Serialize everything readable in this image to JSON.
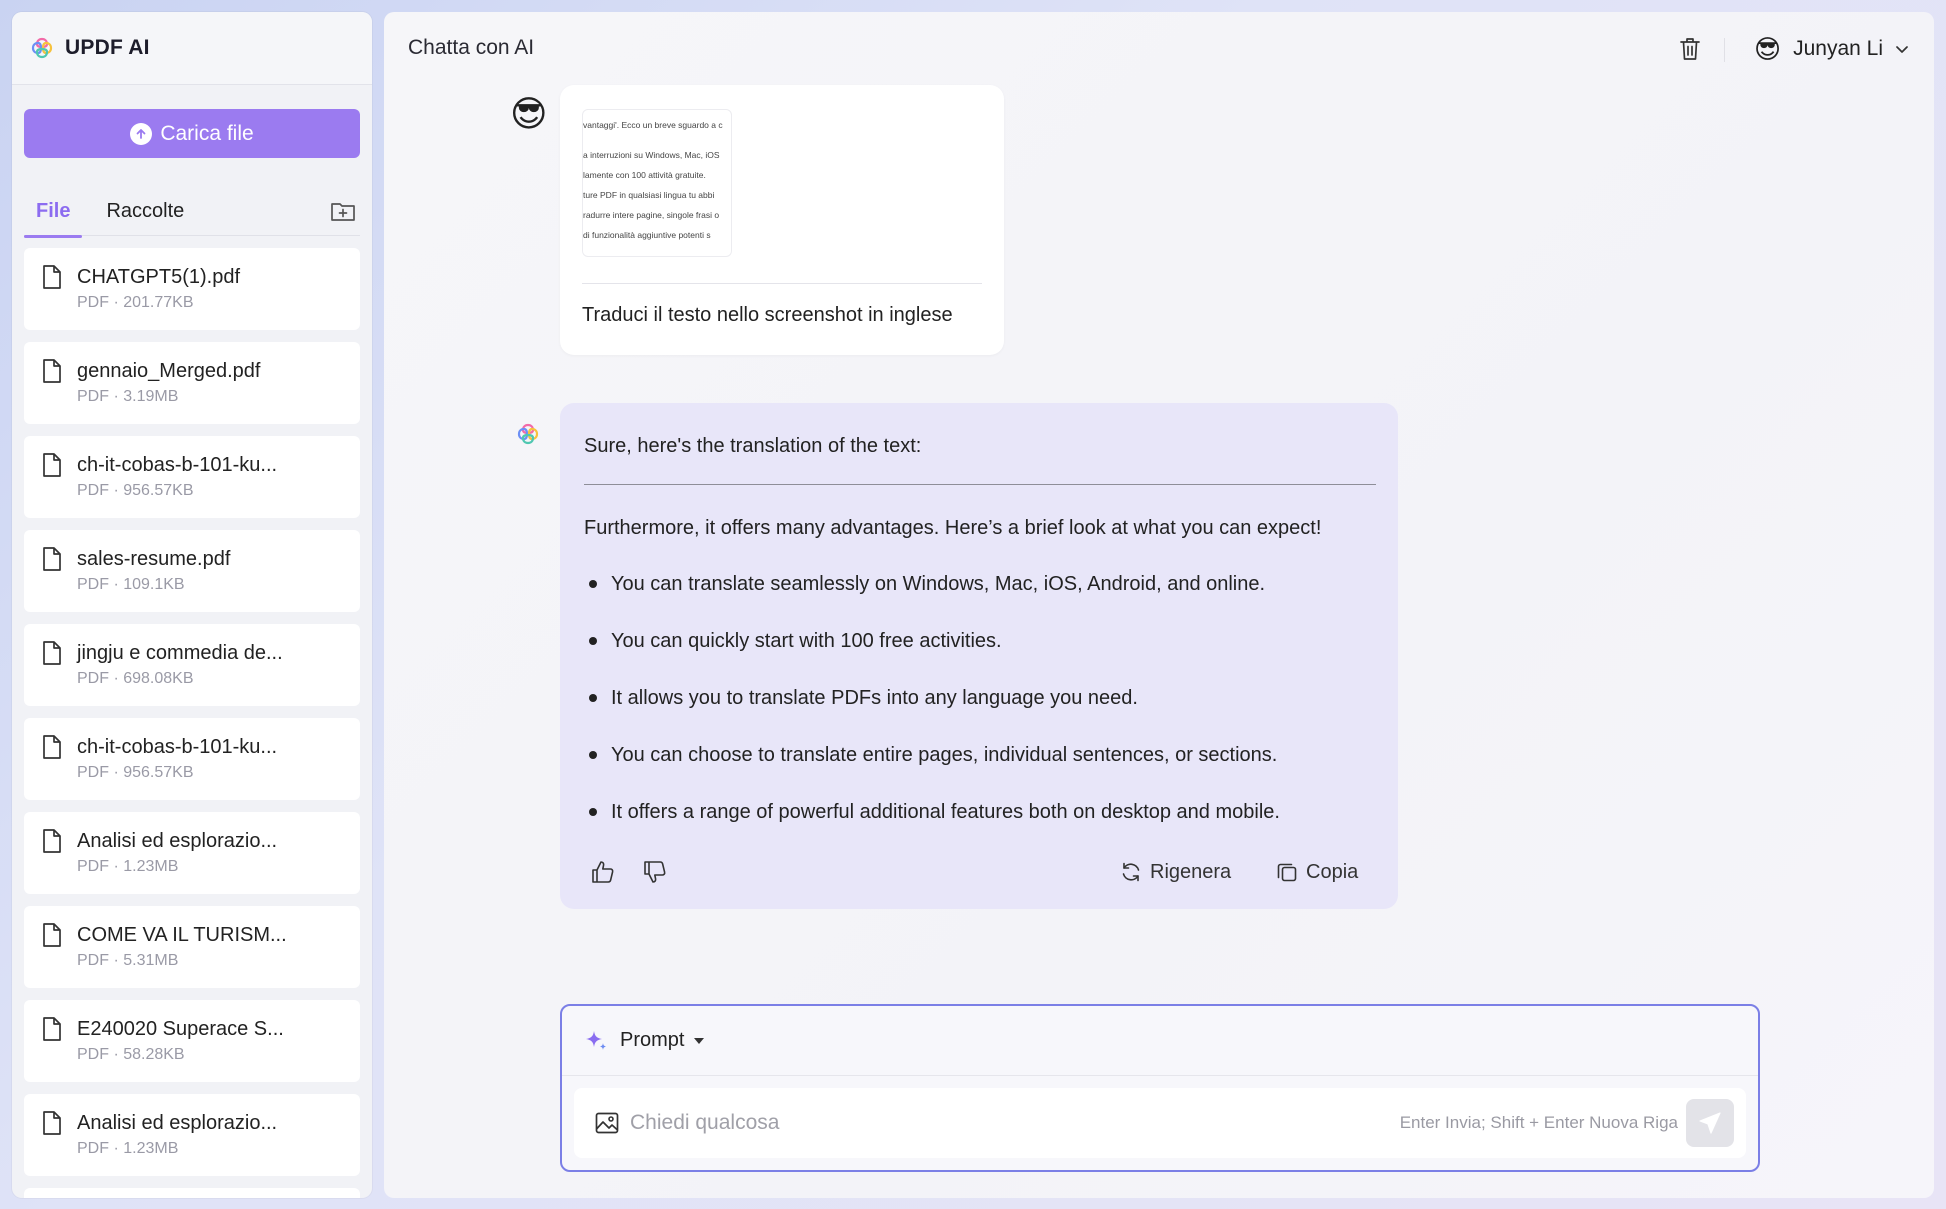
{
  "app": {
    "title": "UPDF AI"
  },
  "sidebar": {
    "upload_label": "Carica file",
    "tabs": [
      {
        "label": "File",
        "active": true
      },
      {
        "label": "Raccolte",
        "active": false
      }
    ],
    "files": [
      {
        "name": "CHATGPT5(1).pdf",
        "meta": "PDF · 201.77KB"
      },
      {
        "name": "gennaio_Merged.pdf",
        "meta": "PDF · 3.19MB"
      },
      {
        "name": "ch-it-cobas-b-101-ku...",
        "meta": "PDF · 956.57KB"
      },
      {
        "name": "sales-resume.pdf",
        "meta": "PDF · 109.1KB"
      },
      {
        "name": "jingju e commedia de...",
        "meta": "PDF · 698.08KB"
      },
      {
        "name": "ch-it-cobas-b-101-ku...",
        "meta": "PDF · 956.57KB"
      },
      {
        "name": "Analisi ed esplorazio...",
        "meta": "PDF · 1.23MB"
      },
      {
        "name": "COME VA IL TURISM...",
        "meta": "PDF · 5.31MB"
      },
      {
        "name": "E240020 Superace S...",
        "meta": "PDF · 58.28KB"
      },
      {
        "name": "Analisi ed esplorazio...",
        "meta": "PDF · 1.23MB"
      }
    ]
  },
  "header": {
    "title": "Chatta con AI",
    "user": {
      "emoji": "😎",
      "name": "Junyan Li"
    }
  },
  "chat": {
    "user_message": {
      "avatar": "😎",
      "screenshot_lines": [
        "vantaggi'. Ecco un breve sguardo a c",
        "a interruzioni su Windows, Mac, iOS",
        "lamente con 100 attività gratuite.",
        "ture PDF in qualsiasi lingua tu abbi",
        "radurre intere pagine, singole frasi o",
        "di funzionalità aggiuntive potenti s"
      ],
      "text": "Traduci il testo nello screenshot in inglese"
    },
    "ai_message": {
      "intro": "Sure, here's the translation of the text:",
      "lead": "Furthermore, it offers many advantages. Here’s a brief look at what you can expect!",
      "bullets": [
        "You can translate seamlessly on Windows, Mac, iOS, Android, and online.",
        "You can quickly start with 100 free activities.",
        "It allows you to translate PDFs into any language you need.",
        "You can choose to translate entire pages, individual sentences, or sections.",
        "It offers a range of powerful additional features both on desktop and mobile."
      ],
      "actions": {
        "regenerate": "Rigenera",
        "copy": "Copia"
      }
    }
  },
  "composer": {
    "prompt_label": "Prompt",
    "placeholder": "Chiedi qualcosa",
    "hint": "Enter Invia; Shift + Enter Nuova Riga"
  },
  "colors": {
    "accent": "#9b7bf0",
    "ai_bubble": "#e8e6f9",
    "composer_border": "#7b7fe6"
  }
}
